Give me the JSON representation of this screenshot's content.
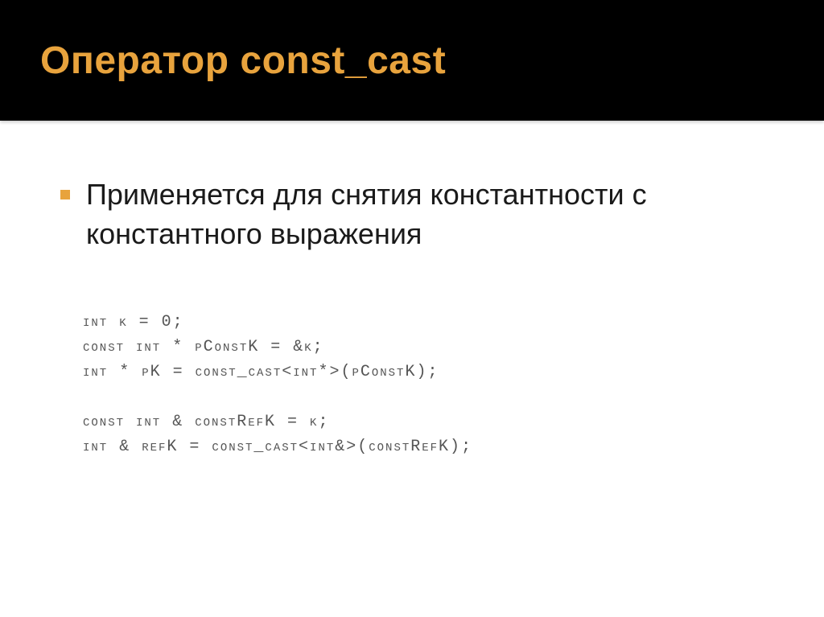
{
  "header": {
    "title": "Оператор const_cast"
  },
  "body": {
    "bullet_text": "Применяется для снятия константности с константного выражения"
  },
  "code": {
    "line1": "int k = 0;",
    "line2": "const int * pConstK = &k;",
    "line3": "int * pK = const_cast<int*>(pConstK);",
    "line4": "",
    "line5": "const int & constRefK = k;",
    "line6": "int & refK = const_cast<int&>(constRefK);"
  }
}
